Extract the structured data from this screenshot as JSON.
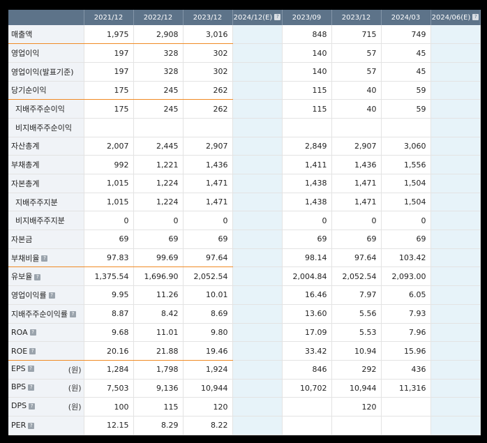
{
  "headers": [
    "",
    "2021/12",
    "2022/12",
    "2023/12",
    "2024/12(E)",
    "2023/09",
    "2023/12",
    "2024/03",
    "2024/06(E)"
  ],
  "rows": [
    {
      "label": "매출액",
      "unit": "",
      "help": false,
      "sub": false,
      "values": [
        "1,975",
        "2,908",
        "3,016",
        "",
        "848",
        "715",
        "749",
        ""
      ]
    },
    {
      "label": "영업이익",
      "unit": "",
      "help": false,
      "sub": false,
      "values": [
        "197",
        "328",
        "302",
        "",
        "140",
        "57",
        "45",
        ""
      ]
    },
    {
      "label": "영업이익(발표기준)",
      "unit": "",
      "help": false,
      "sub": false,
      "values": [
        "197",
        "328",
        "302",
        "",
        "140",
        "57",
        "45",
        ""
      ]
    },
    {
      "label": "당기순이익",
      "unit": "",
      "help": false,
      "sub": false,
      "values": [
        "175",
        "245",
        "262",
        "",
        "115",
        "40",
        "59",
        ""
      ]
    },
    {
      "label": "지배주주순이익",
      "unit": "",
      "help": false,
      "sub": true,
      "values": [
        "175",
        "245",
        "262",
        "",
        "115",
        "40",
        "59",
        ""
      ]
    },
    {
      "label": "비지배주주순이익",
      "unit": "",
      "help": false,
      "sub": true,
      "values": [
        "",
        "",
        "",
        "",
        "",
        "",
        "",
        ""
      ]
    },
    {
      "label": "자산총계",
      "unit": "",
      "help": false,
      "sub": false,
      "values": [
        "2,007",
        "2,445",
        "2,907",
        "",
        "2,849",
        "2,907",
        "3,060",
        ""
      ]
    },
    {
      "label": "부채총계",
      "unit": "",
      "help": false,
      "sub": false,
      "values": [
        "992",
        "1,221",
        "1,436",
        "",
        "1,411",
        "1,436",
        "1,556",
        ""
      ]
    },
    {
      "label": "자본총계",
      "unit": "",
      "help": false,
      "sub": false,
      "values": [
        "1,015",
        "1,224",
        "1,471",
        "",
        "1,438",
        "1,471",
        "1,504",
        ""
      ]
    },
    {
      "label": "지배주주지분",
      "unit": "",
      "help": false,
      "sub": true,
      "values": [
        "1,015",
        "1,224",
        "1,471",
        "",
        "1,438",
        "1,471",
        "1,504",
        ""
      ]
    },
    {
      "label": "비지배주주지분",
      "unit": "",
      "help": false,
      "sub": true,
      "values": [
        "0",
        "0",
        "0",
        "",
        "0",
        "0",
        "0",
        ""
      ]
    },
    {
      "label": "자본금",
      "unit": "",
      "help": false,
      "sub": false,
      "values": [
        "69",
        "69",
        "69",
        "",
        "69",
        "69",
        "69",
        ""
      ]
    },
    {
      "label": "부채비율",
      "unit": "",
      "help": true,
      "sub": false,
      "values": [
        "97.83",
        "99.69",
        "97.64",
        "",
        "98.14",
        "97.64",
        "103.42",
        ""
      ]
    },
    {
      "label": "유보율",
      "unit": "",
      "help": true,
      "sub": false,
      "values": [
        "1,375.54",
        "1,696.90",
        "2,052.54",
        "",
        "2,004.84",
        "2,052.54",
        "2,093.00",
        ""
      ]
    },
    {
      "label": "영업이익률",
      "unit": "",
      "help": true,
      "sub": false,
      "values": [
        "9.95",
        "11.26",
        "10.01",
        "",
        "16.46",
        "7.97",
        "6.05",
        ""
      ]
    },
    {
      "label": "지배주주순이익률",
      "unit": "",
      "help": true,
      "sub": false,
      "values": [
        "8.87",
        "8.42",
        "8.69",
        "",
        "13.60",
        "5.56",
        "7.93",
        ""
      ]
    },
    {
      "label": "ROA",
      "unit": "",
      "help": true,
      "sub": false,
      "values": [
        "9.68",
        "11.01",
        "9.80",
        "",
        "17.09",
        "5.53",
        "7.96",
        ""
      ]
    },
    {
      "label": "ROE",
      "unit": "",
      "help": true,
      "sub": false,
      "values": [
        "20.16",
        "21.88",
        "19.46",
        "",
        "33.42",
        "10.94",
        "15.96",
        ""
      ]
    },
    {
      "label": "EPS",
      "unit": "(원)",
      "help": true,
      "sub": false,
      "values": [
        "1,284",
        "1,798",
        "1,924",
        "",
        "846",
        "292",
        "436",
        ""
      ]
    },
    {
      "label": "BPS",
      "unit": "(원)",
      "help": true,
      "sub": false,
      "values": [
        "7,503",
        "9,136",
        "10,944",
        "",
        "10,702",
        "10,944",
        "11,316",
        ""
      ]
    },
    {
      "label": "DPS",
      "unit": "(원)",
      "help": true,
      "sub": false,
      "values": [
        "100",
        "115",
        "120",
        "",
        "",
        "120",
        "",
        ""
      ]
    },
    {
      "label": "PER",
      "unit": "",
      "help": true,
      "sub": false,
      "values": [
        "12.15",
        "8.29",
        "8.22",
        "",
        "",
        "",
        "",
        ""
      ]
    }
  ],
  "orange_after_rows": [
    0,
    3,
    12,
    17
  ],
  "help_icon": "?",
  "estimate_columns": [
    3,
    7
  ]
}
